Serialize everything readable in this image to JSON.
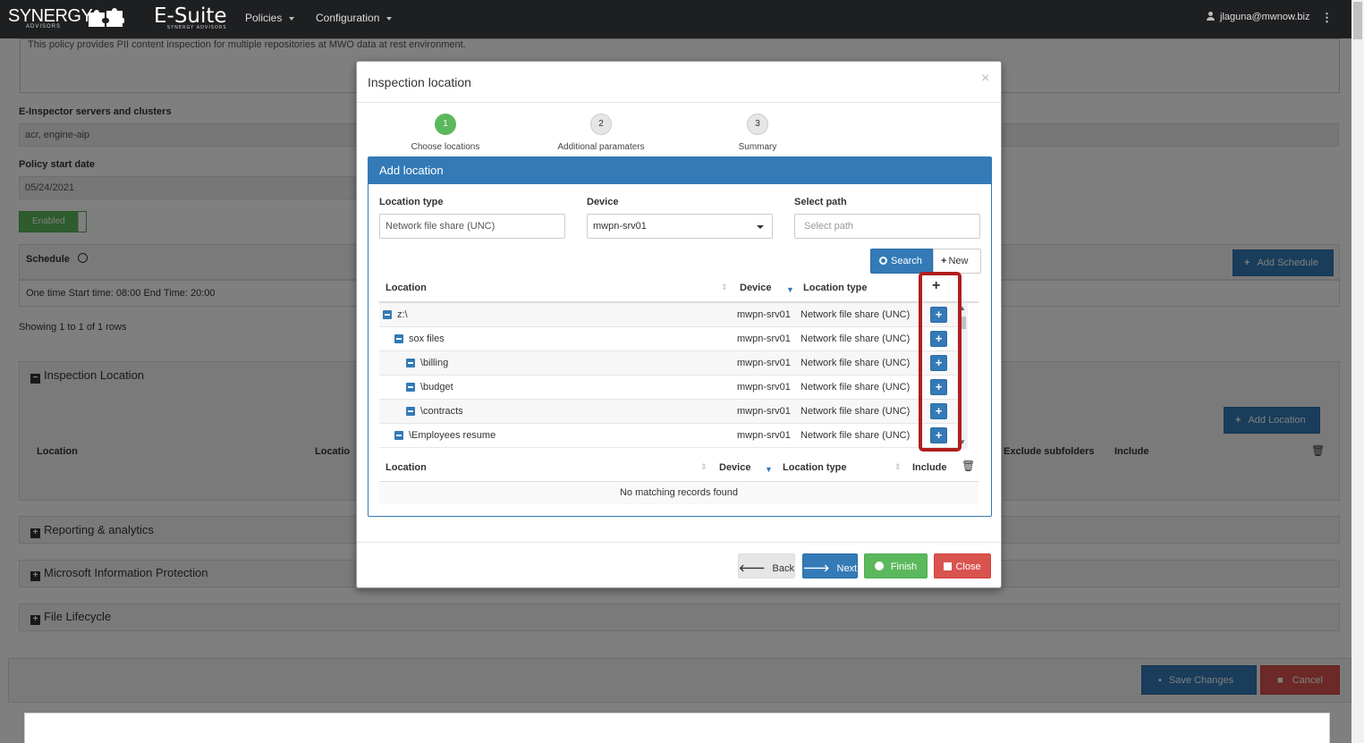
{
  "navbar": {
    "brand": "SYNERGY",
    "brand_sub": "ADVISORS",
    "product": "E-Suite",
    "product_sub": "SYNERGY ADVISORS",
    "menu": [
      "Policies",
      "Configuration"
    ],
    "user": "jlaguna@mwnow.biz"
  },
  "background": {
    "description_text": "This policy provides PII content inspection for multiple repositories at MWO data at rest environment.",
    "servers_label": "E-Inspector servers and clusters",
    "servers_value": "acr, engine-aip",
    "start_date_label": "Policy start date",
    "start_date_value": "05/24/2021",
    "toggle_label": "Enabled",
    "schedule_label": "Schedule",
    "add_schedule": "Add Schedule",
    "schedule_row": "One time Start time: 08:00 End Time: 20:00",
    "showing": "Showing 1 to 1 of 1 rows",
    "inspection_location": "Inspection Location",
    "add_location": "Add Location",
    "loc_headers": [
      "Location",
      "Locatio",
      "Exclude subfolders",
      "Include"
    ],
    "panels": [
      "Reporting & analytics",
      "Microsoft Information Protection",
      "File Lifecycle"
    ],
    "save_changes": "Save Changes",
    "cancel": "Cancel"
  },
  "modal": {
    "title": "Inspection location",
    "close_glyph": "×",
    "steps": [
      {
        "num": "1",
        "label": "Choose locations",
        "active": true
      },
      {
        "num": "2",
        "label": "Additional paramaters",
        "active": false
      },
      {
        "num": "3",
        "label": "Summary",
        "active": false
      }
    ],
    "panel_title": "Add location",
    "fields": {
      "location_type_label": "Location type",
      "location_type_value": "Network file share (UNC)",
      "device_label": "Device",
      "device_value": "mwpn-srv01",
      "path_label": "Select path",
      "path_placeholder": "Select path"
    },
    "search_button": "Search",
    "new_button": "New",
    "tree_headers": {
      "location": "Location",
      "device": "Device",
      "type": "Location type",
      "add": "+"
    },
    "tree_rows": [
      {
        "name": "z:\\",
        "device": "mwpn-srv01",
        "type": "Network file share (UNC)"
      },
      {
        "name": "sox files",
        "device": "mwpn-srv01",
        "type": "Network file share (UNC)"
      },
      {
        "name": "\\billing",
        "device": "mwpn-srv01",
        "type": "Network file share (UNC)"
      },
      {
        "name": "\\budget",
        "device": "mwpn-srv01",
        "type": "Network file share (UNC)"
      },
      {
        "name": "\\contracts",
        "device": "mwpn-srv01",
        "type": "Network file share (UNC)"
      },
      {
        "name": "\\Employees resume",
        "device": "mwpn-srv01",
        "type": "Network file share (UNC)"
      }
    ],
    "selected_headers": {
      "location": "Location",
      "device": "Device",
      "type": "Location type",
      "include": "Include"
    },
    "no_records": "No matching records found",
    "buttons": {
      "back": "Back",
      "next": "Next",
      "finish": "Finish",
      "close": "Close"
    }
  },
  "colors": {
    "primary": "#337ab7",
    "success": "#5cb85c",
    "danger": "#d9534f",
    "highlight": "#b01e1e",
    "navbar": "#1e1f21"
  }
}
